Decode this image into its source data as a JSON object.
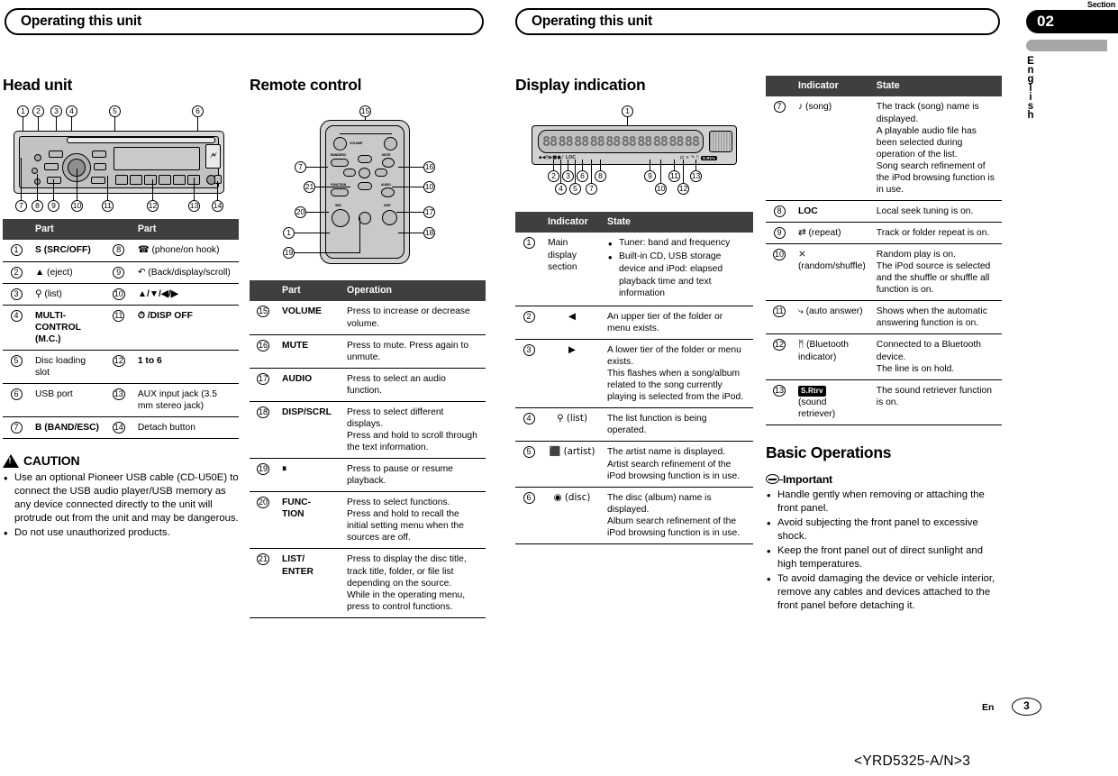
{
  "running_head": {
    "left": "Operating this unit",
    "right": "Operating this unit"
  },
  "section_tab": {
    "label": "Section",
    "number": "02",
    "language": "English"
  },
  "footer": {
    "lang_code": "En",
    "page": "3",
    "doc_code": "<YRD5325-A/N>3"
  },
  "head_unit": {
    "title": "Head unit",
    "table_headers": {
      "num": "",
      "part_a": "Part",
      "num_b": "",
      "part_b": "Part"
    },
    "rows": [
      {
        "n1": "1",
        "p1": "S (SRC/OFF)",
        "p1_bold": true,
        "n2": "8",
        "p2": "☎ (phone/on hook)",
        "p2_bold": false
      },
      {
        "n1": "2",
        "p1": "▲ (eject)",
        "p1_bold": false,
        "n2": "9",
        "p2": "↶ (Back/display/scroll)",
        "p2_bold": false
      },
      {
        "n1": "3",
        "p1": "⚲ (list)",
        "p1_bold": false,
        "n2": "10",
        "p2": "▲/▼/◀/▶",
        "p2_bold": true
      },
      {
        "n1": "4",
        "p1": "MULTI-CONTROL (M.C.)",
        "p1_bold": true,
        "n2": "11",
        "p2": "⏱ /DISP OFF",
        "p2_bold": true
      },
      {
        "n1": "5",
        "p1": "Disc loading slot",
        "p1_bold": false,
        "n2": "12",
        "p2": "1 to 6",
        "p2_bold": true
      },
      {
        "n1": "6",
        "p1": "USB port",
        "p1_bold": false,
        "n2": "13",
        "p2": "AUX input jack (3.5 mm stereo jack)",
        "p2_bold": false
      },
      {
        "n1": "7",
        "p1": "B (BAND/ESC)",
        "p1_bold": true,
        "n2": "14",
        "p2": "Detach button",
        "p2_bold": false
      }
    ],
    "illustration_callouts": [
      "1",
      "2",
      "3",
      "4",
      "5",
      "6",
      "7",
      "8",
      "9",
      "10",
      "11",
      "12",
      "13",
      "14"
    ]
  },
  "caution": {
    "title": "CAUTION",
    "items": [
      "Use an optional Pioneer USB cable (CD-U50E) to connect the USB audio player/USB memory as any device connected directly to the unit will protrude out from the unit and may be dangerous.",
      "Do not use unauthorized products."
    ]
  },
  "remote_control": {
    "title": "Remote control",
    "table_headers": {
      "num": "",
      "part": "Part",
      "operation": "Operation"
    },
    "rows": [
      {
        "n": "15",
        "part": "VOLUME",
        "op": "Press to increase or decrease volume."
      },
      {
        "n": "16",
        "part": "MUTE",
        "op": "Press to mute. Press again to unmute."
      },
      {
        "n": "17",
        "part": "AUDIO",
        "op": "Press to select an audio function."
      },
      {
        "n": "18",
        "part": "DISP/SCRL",
        "op": "Press to select different displays.\nPress and hold to scroll through the text information."
      },
      {
        "n": "19",
        "part": "⏸",
        "op": "Press to pause or resume playback."
      },
      {
        "n": "20",
        "part": "FUNC-TION",
        "op": "Press to select functions.\nPress and hold to recall the initial setting menu when the sources are off."
      },
      {
        "n": "21",
        "part": "LIST/ENTER",
        "op": "Press to display the disc title, track title, folder, or file list depending on the source.\nWhile in the operating menu, press to control functions."
      }
    ],
    "illustration_callouts": [
      "15",
      "7",
      "21",
      "20",
      "1",
      "19",
      "16",
      "10",
      "17",
      "18"
    ],
    "illustration_labels": [
      "VOLUME",
      "BAND/ESC",
      "MUTE",
      "FUNCTION",
      "AUDIO",
      "SRC",
      "DISP"
    ]
  },
  "display_indication": {
    "title": "Display indication",
    "table_headers": {
      "num": "",
      "indicator": "Indicator",
      "state": "State"
    },
    "rows": [
      {
        "n": "1",
        "ind": "Main display section",
        "ind_kind": "text",
        "state_bullets": [
          "Tuner: band and frequency",
          "Built-in CD, USB storage device and iPod: elapsed playback time and text information"
        ]
      },
      {
        "n": "2",
        "ind": "◀",
        "ind_kind": "sym",
        "state": "An upper tier of the folder or menu exists."
      },
      {
        "n": "3",
        "ind": "▶",
        "ind_kind": "sym",
        "state": "A lower tier of the folder or menu exists.\nThis flashes when a song/album related to the song currently playing is selected from the iPod."
      },
      {
        "n": "4",
        "ind": "⚲ (list)",
        "ind_kind": "sym",
        "state": "The list function is being operated."
      },
      {
        "n": "5",
        "ind": "⬛ (artist)",
        "ind_kind": "sym",
        "state": "The artist name is displayed.\nArtist search refinement of the iPod browsing function is in use."
      },
      {
        "n": "6",
        "ind": "◉ (disc)",
        "ind_kind": "sym",
        "state": "The disc (album) name is displayed.\nAlbum search refinement of the iPod browsing function is in use."
      }
    ],
    "illustration_callouts": [
      "1",
      "2",
      "3",
      "4",
      "5",
      "6",
      "7",
      "8",
      "9",
      "10",
      "11",
      "12",
      "13"
    ],
    "illustration_loc_text": "LOC",
    "illustration_srtv_text": "S.Rtrv"
  },
  "display_indication_2": {
    "table_headers": {
      "num": "",
      "indicator": "Indicator",
      "state": "State"
    },
    "rows": [
      {
        "n": "7",
        "ind": "♪ (song)",
        "state": "The track (song) name is displayed.\nA playable audio file has been selected during operation of the list.\nSong search refinement of the iPod browsing function is in use."
      },
      {
        "n": "8",
        "ind": "LOC",
        "ind_bold": true,
        "state": "Local seek tuning is on."
      },
      {
        "n": "9",
        "ind": "⇄ (repeat)",
        "state": "Track or folder repeat is on."
      },
      {
        "n": "10",
        "ind": "⨯ (random/shuffle)",
        "state": "Random play is on.\nThe iPod source is selected and the shuffle or shuffle all function is on."
      },
      {
        "n": "11",
        "ind": "⤷ (auto answer)",
        "state": "Shows when the automatic answering function is on."
      },
      {
        "n": "12",
        "ind": "ᛗ (Bluetooth indicator)",
        "state": "Connected to a Bluetooth device.\nThe line is on hold."
      },
      {
        "n": "13",
        "ind": "S.Rtrv (sound retriever)",
        "ind_badge": "S.Rtrv",
        "ind_suffix": "(sound retriever)",
        "state": "The sound retriever function is on."
      }
    ]
  },
  "basic_operations": {
    "title": "Basic Operations",
    "important_label": "Important",
    "items": [
      "Handle gently when removing or attaching the front panel.",
      "Avoid subjecting the front panel to excessive shock.",
      "Keep the front panel out of direct sunlight and high temperatures.",
      "To avoid damaging the device or vehicle interior, remove any cables and devices attached to the front panel before detaching it."
    ]
  },
  "colors": {
    "table_header_bg": "#3f3f3f",
    "table_header_fg": "#ffffff",
    "section_tab_bg": "#000000",
    "section_gray_bar": "#a6a6a6",
    "illustration_body": "#d2d2d2"
  }
}
